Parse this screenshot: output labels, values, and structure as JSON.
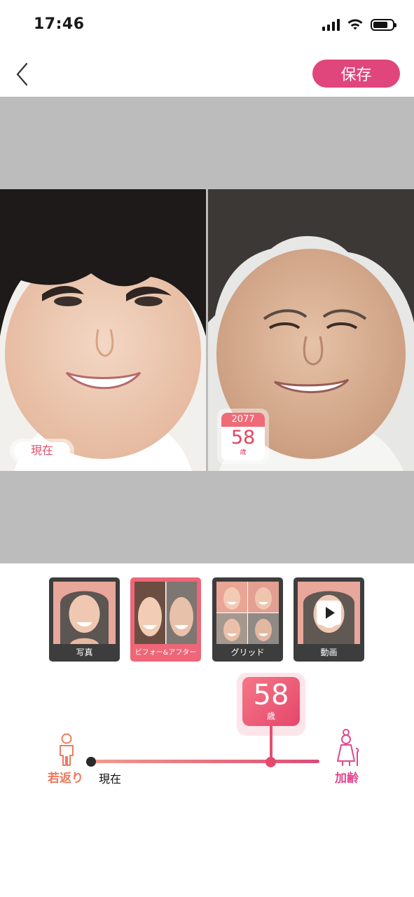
{
  "status_bar": {
    "time": "17:46"
  },
  "header": {
    "save_label": "保存"
  },
  "preview": {
    "left_badge": "現在",
    "right_calendar": {
      "year": "2077",
      "age": "58",
      "unit": "歳"
    }
  },
  "modes": [
    {
      "label": "写真"
    },
    {
      "label": "ビフォー&アフター",
      "selected": true
    },
    {
      "label": "グリッド"
    },
    {
      "label": "動画"
    }
  ],
  "age_slider": {
    "age": "58",
    "unit": "歳",
    "position": 0.79,
    "left_label": "若返り",
    "now_label": "現在",
    "right_label": "加齢"
  },
  "colors": {
    "accent": "#e0457b",
    "active_tile": "#ee6677",
    "rejuvenate": "#ee7a5d",
    "aging": "#e2488e"
  }
}
